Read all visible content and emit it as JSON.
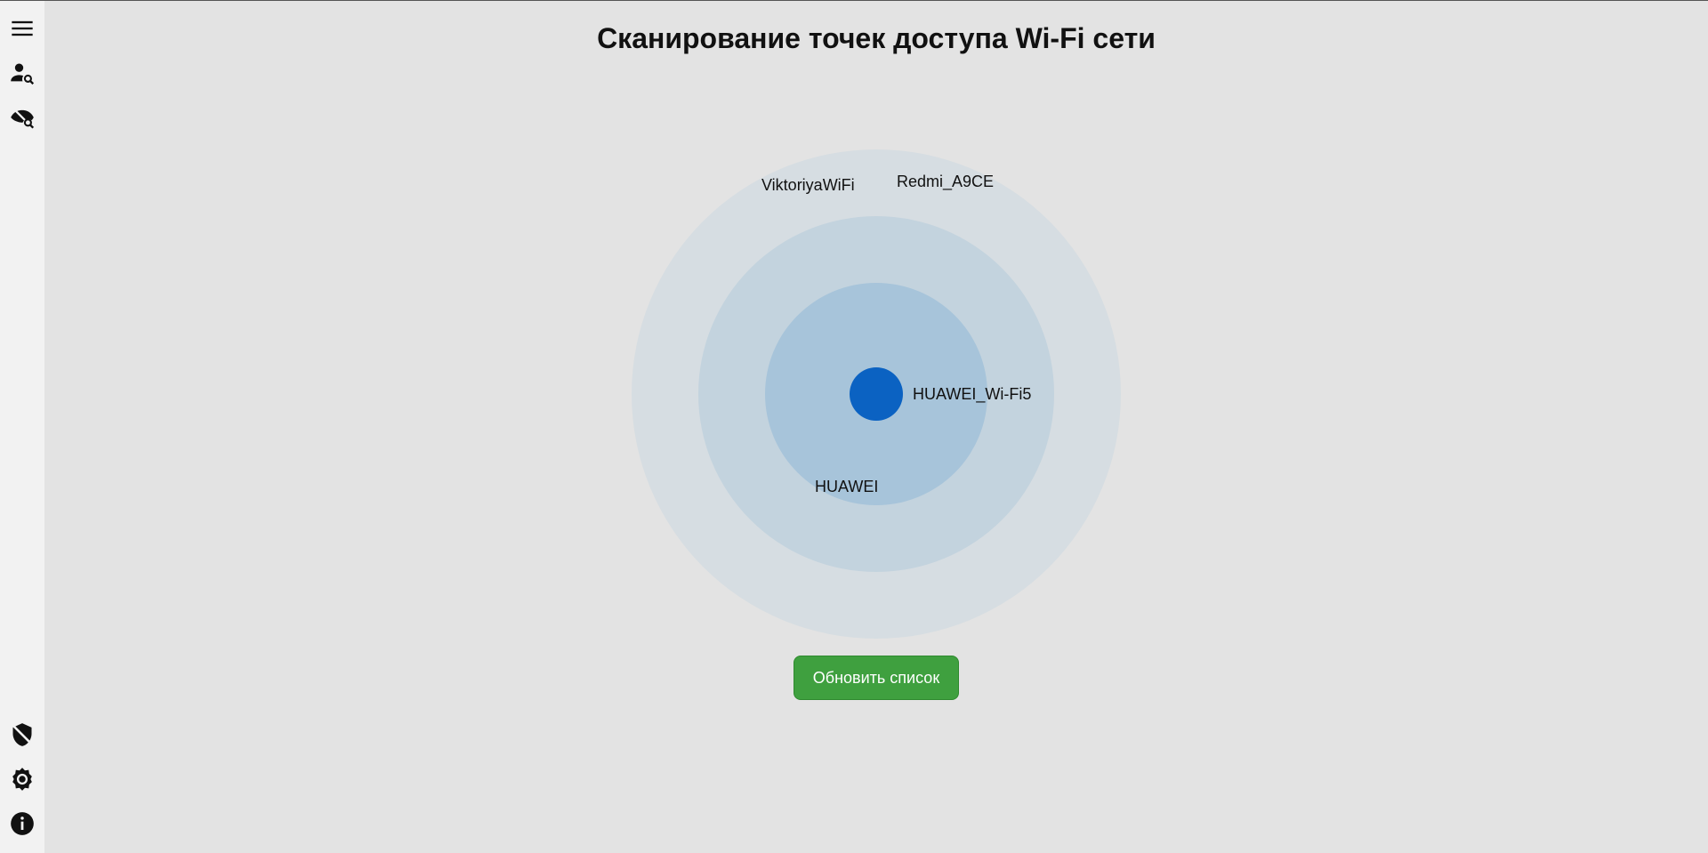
{
  "page": {
    "title": "Сканирование точек доступа Wi-Fi сети"
  },
  "sidebar": {
    "top_icons": [
      "menu-icon",
      "user-search-icon",
      "eye-off-search-icon"
    ],
    "bottom_icons": [
      "shield-off-icon",
      "settings-icon",
      "info-icon"
    ]
  },
  "radar": {
    "colors": {
      "outer": "#d6dde2",
      "middle": "#c3d3de",
      "inner": "#a7c4da",
      "center": "#0b62c2"
    },
    "access_points": [
      {
        "name": "ViktoriyaWiFi"
      },
      {
        "name": "Redmi_A9CE"
      },
      {
        "name": "HUAWEI_Wi-Fi5"
      },
      {
        "name": "HUAWEI"
      }
    ]
  },
  "actions": {
    "refresh_label": "Обновить список",
    "refresh_color": "#3fa03f"
  }
}
